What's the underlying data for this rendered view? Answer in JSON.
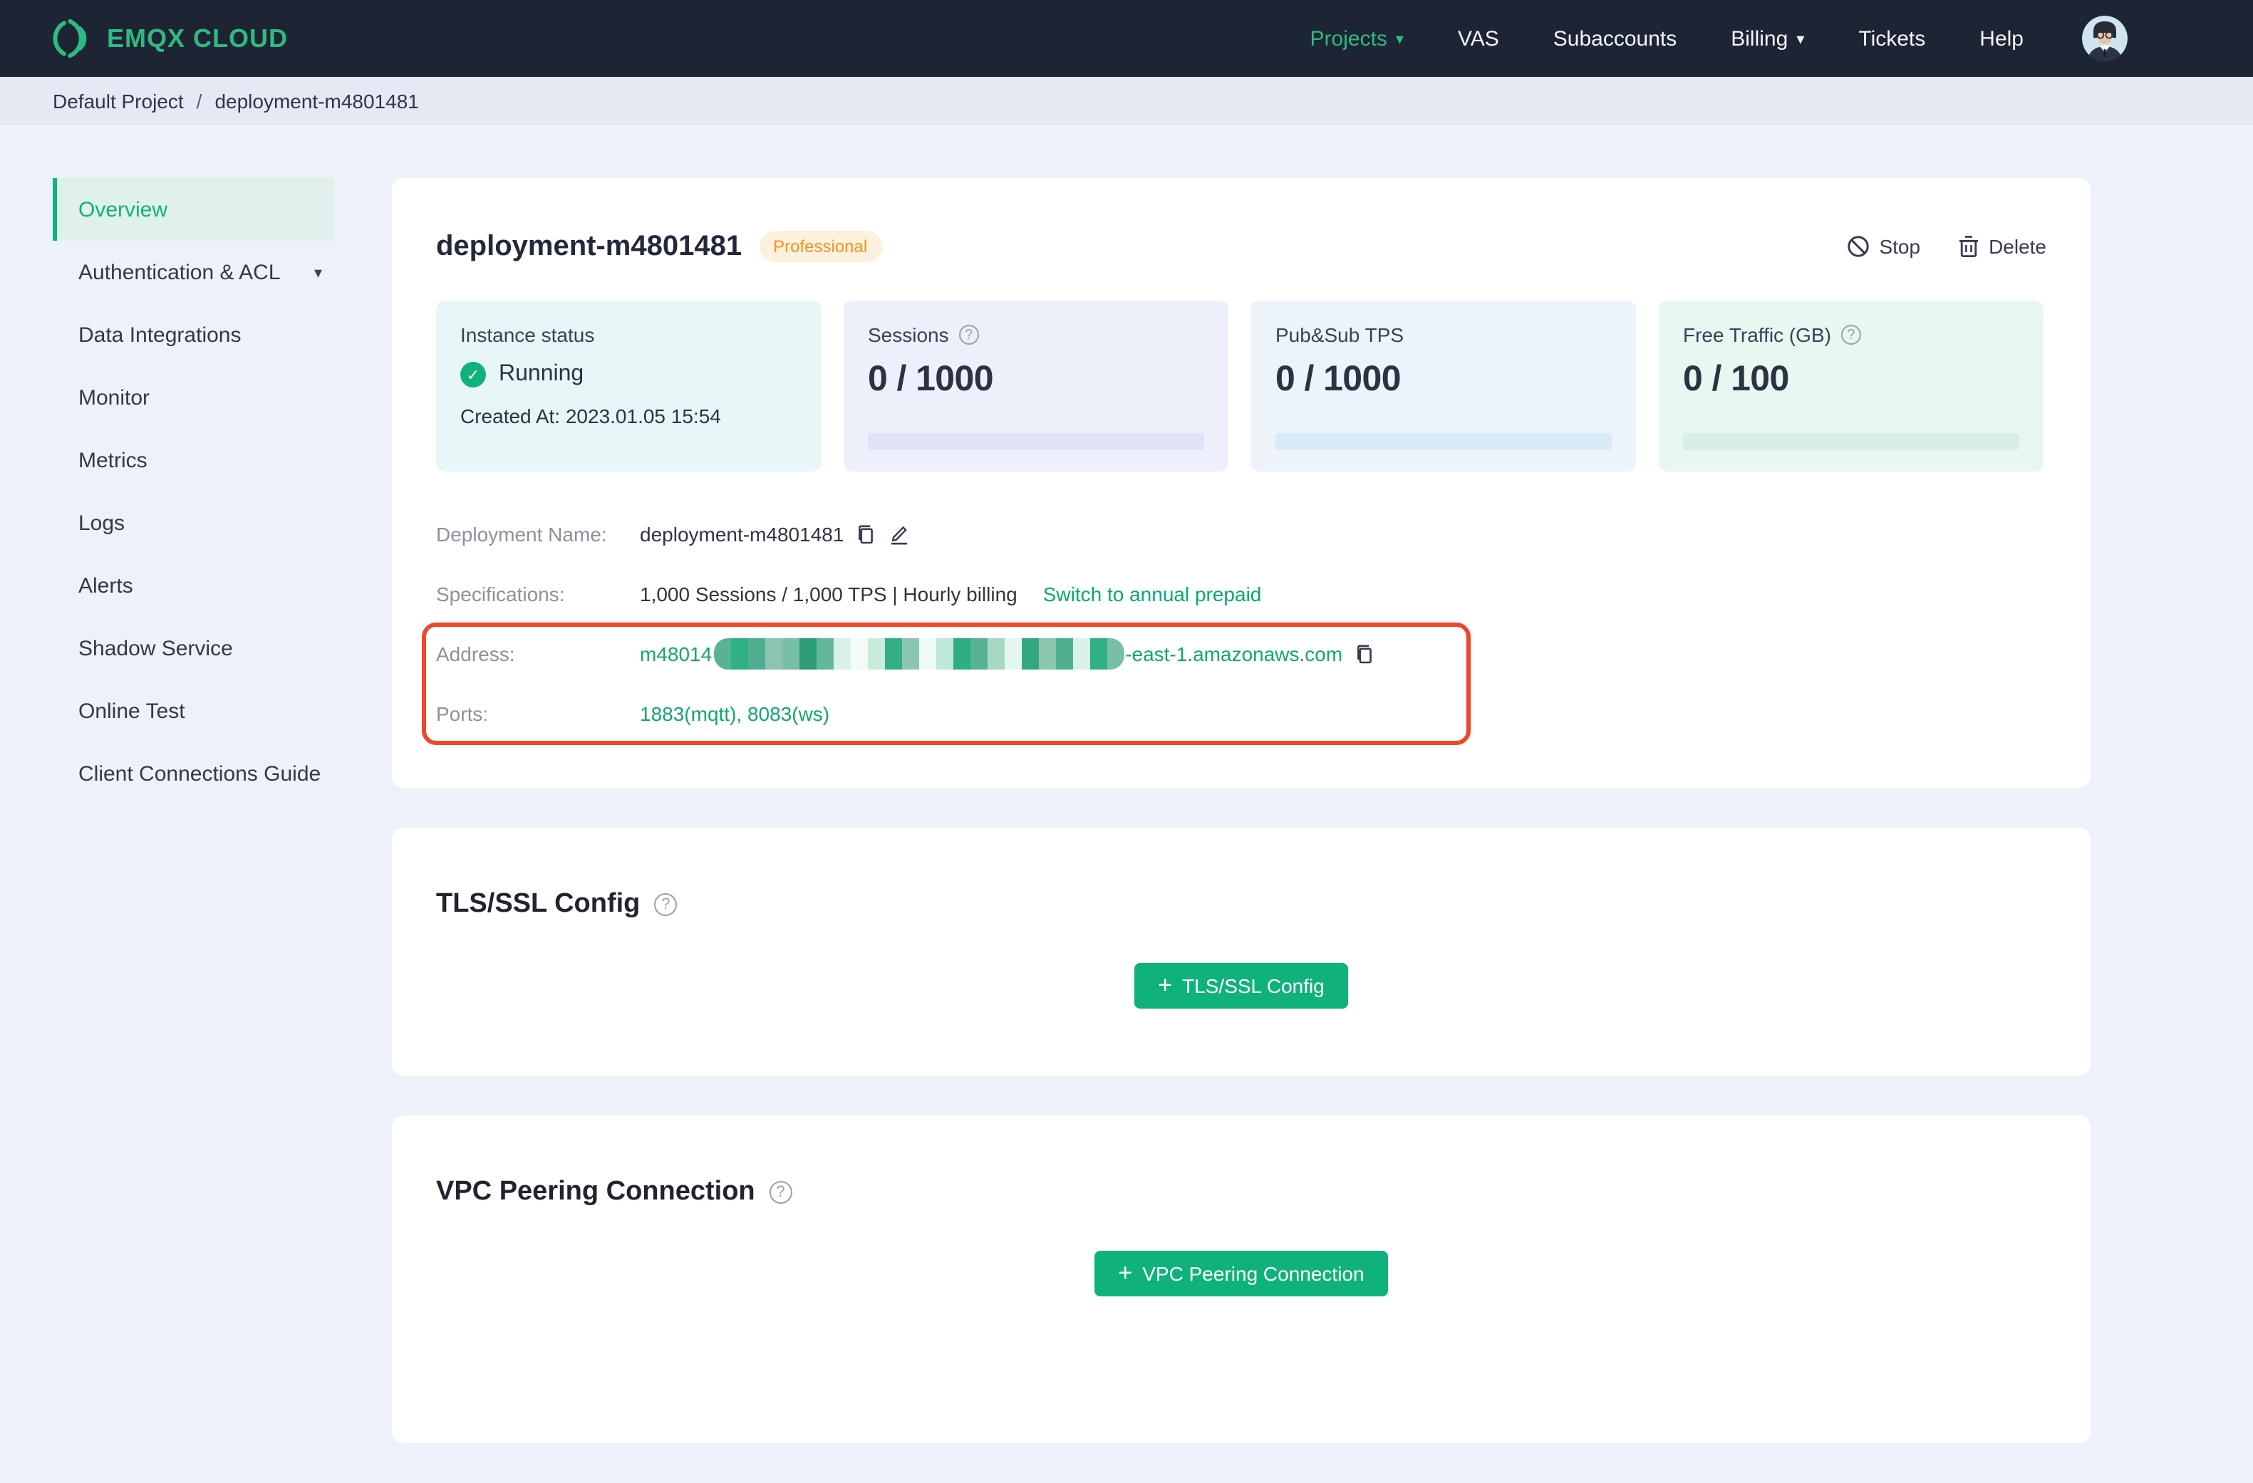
{
  "brand": {
    "name": "EMQX CLOUD"
  },
  "topnav": {
    "items": [
      {
        "label": "Projects",
        "active": true,
        "caret": true
      },
      {
        "label": "VAS"
      },
      {
        "label": "Subaccounts"
      },
      {
        "label": "Billing",
        "caret": true
      },
      {
        "label": "Tickets"
      },
      {
        "label": "Help"
      }
    ]
  },
  "breadcrumb": {
    "project": "Default Project",
    "separator": "/",
    "current": "deployment-m4801481"
  },
  "sidebar": {
    "items": [
      {
        "label": "Overview",
        "active": true
      },
      {
        "label": "Authentication & ACL",
        "caret": true
      },
      {
        "label": "Data Integrations"
      },
      {
        "label": "Monitor"
      },
      {
        "label": "Metrics"
      },
      {
        "label": "Logs"
      },
      {
        "label": "Alerts"
      },
      {
        "label": "Shadow Service"
      },
      {
        "label": "Online Test"
      },
      {
        "label": "Client Connections Guide"
      }
    ]
  },
  "deployment": {
    "title": "deployment-m4801481",
    "badge": "Professional",
    "actions": {
      "stop": "Stop",
      "delete": "Delete"
    },
    "stats": {
      "instance": {
        "label": "Instance status",
        "status": "Running",
        "created": "Created At: 2023.01.05 15:54"
      },
      "sessions": {
        "label": "Sessions",
        "value": "0 / 1000"
      },
      "tps": {
        "label": "Pub&Sub TPS",
        "value": "0 / 1000"
      },
      "traffic": {
        "label": "Free Traffic (GB)",
        "value": "0 / 100"
      }
    },
    "details": {
      "name_label": "Deployment Name:",
      "name_value": "deployment-m4801481",
      "spec_label": "Specifications:",
      "spec_value": "1,000 Sessions / 1,000 TPS | Hourly billing",
      "spec_link": "Switch to annual prepaid",
      "address_label": "Address:",
      "address_prefix": "m48014",
      "address_suffix": "-east-1.amazonaws.com",
      "address_redacted": true,
      "redaction_blocks": [
        "#57b394",
        "#2fb183",
        "#4fae92",
        "#8cc4b0",
        "#79bfa5",
        "#2e9b77",
        "#63b89c",
        "#d9f2e7",
        "#f2fbf7",
        "#c8ecd9",
        "#35ae85",
        "#8bc7af",
        "#eefaf4",
        "#bfe8d6",
        "#2fae83",
        "#57b394",
        "#a8d8c3",
        "#e4f7ee",
        "#35a77f",
        "#8bc7af",
        "#4fb08f",
        "#d9f2e7",
        "#2fb183",
        "#79bfa5"
      ],
      "ports_label": "Ports:",
      "ports_value": "1883(mqtt), 8083(ws)"
    }
  },
  "tls": {
    "title": "TLS/SSL Config",
    "button_label": "TLS/SSL Config"
  },
  "vpc": {
    "title": "VPC Peering Connection",
    "button_label": "VPC Peering Connection"
  },
  "icons": {
    "caret_down": "▾",
    "plus": "+",
    "check": "✓",
    "question": "?"
  },
  "colors": {
    "accent_green": "#10b27c",
    "brand_green": "#2eba81",
    "annotation_red": "#f0472b",
    "badge_orange": "#f5921f",
    "navbar_dark": "#1d2433"
  }
}
